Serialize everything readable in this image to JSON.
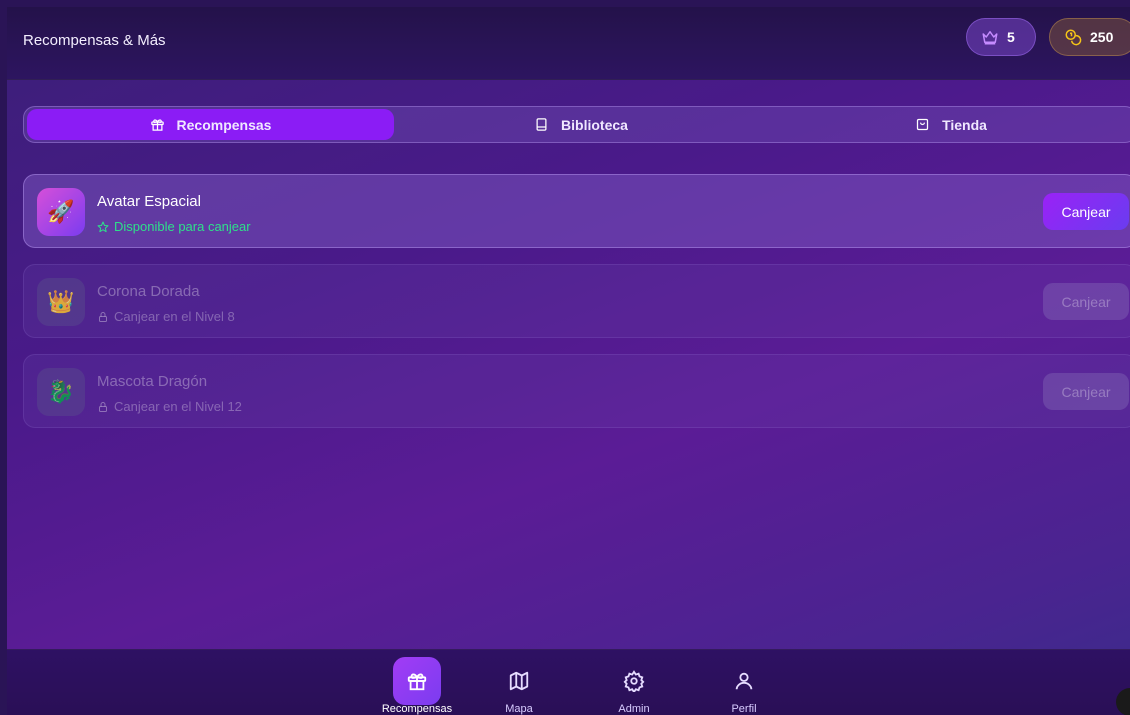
{
  "header": {
    "title": "Recompensas & Más",
    "level": "5",
    "coins": "250"
  },
  "tabs": [
    {
      "label": "Recompensas",
      "icon": "gift-icon",
      "active": true
    },
    {
      "label": "Biblioteca",
      "icon": "book-icon",
      "active": false
    },
    {
      "label": "Tienda",
      "icon": "shopping-bag-icon",
      "active": false
    }
  ],
  "rewards": [
    {
      "title": "Avatar Espacial",
      "status": "Disponible para canjear",
      "icon": "🚀",
      "icon_name": "rocket-icon",
      "button": "Canjear",
      "available": true
    },
    {
      "title": "Corona Dorada",
      "status": "Canjear en el Nivel 8",
      "icon": "👑",
      "icon_name": "crown-icon",
      "button": "Canjear",
      "available": false
    },
    {
      "title": "Mascota Dragón",
      "status": "Canjear en el Nivel 12",
      "icon": "🐉",
      "icon_name": "dragon-icon",
      "button": "Canjear",
      "available": false
    }
  ],
  "nav": [
    {
      "label": "Recompensas",
      "icon": "gift-icon",
      "active": true
    },
    {
      "label": "Mapa",
      "icon": "map-icon",
      "active": false
    },
    {
      "label": "Admin",
      "icon": "gear-icon",
      "active": false
    },
    {
      "label": "Perfil",
      "icon": "user-icon",
      "active": false
    }
  ],
  "colors": {
    "accent": "#8b1cf5",
    "available": "#2ee08a",
    "coin": "#f5c518"
  }
}
